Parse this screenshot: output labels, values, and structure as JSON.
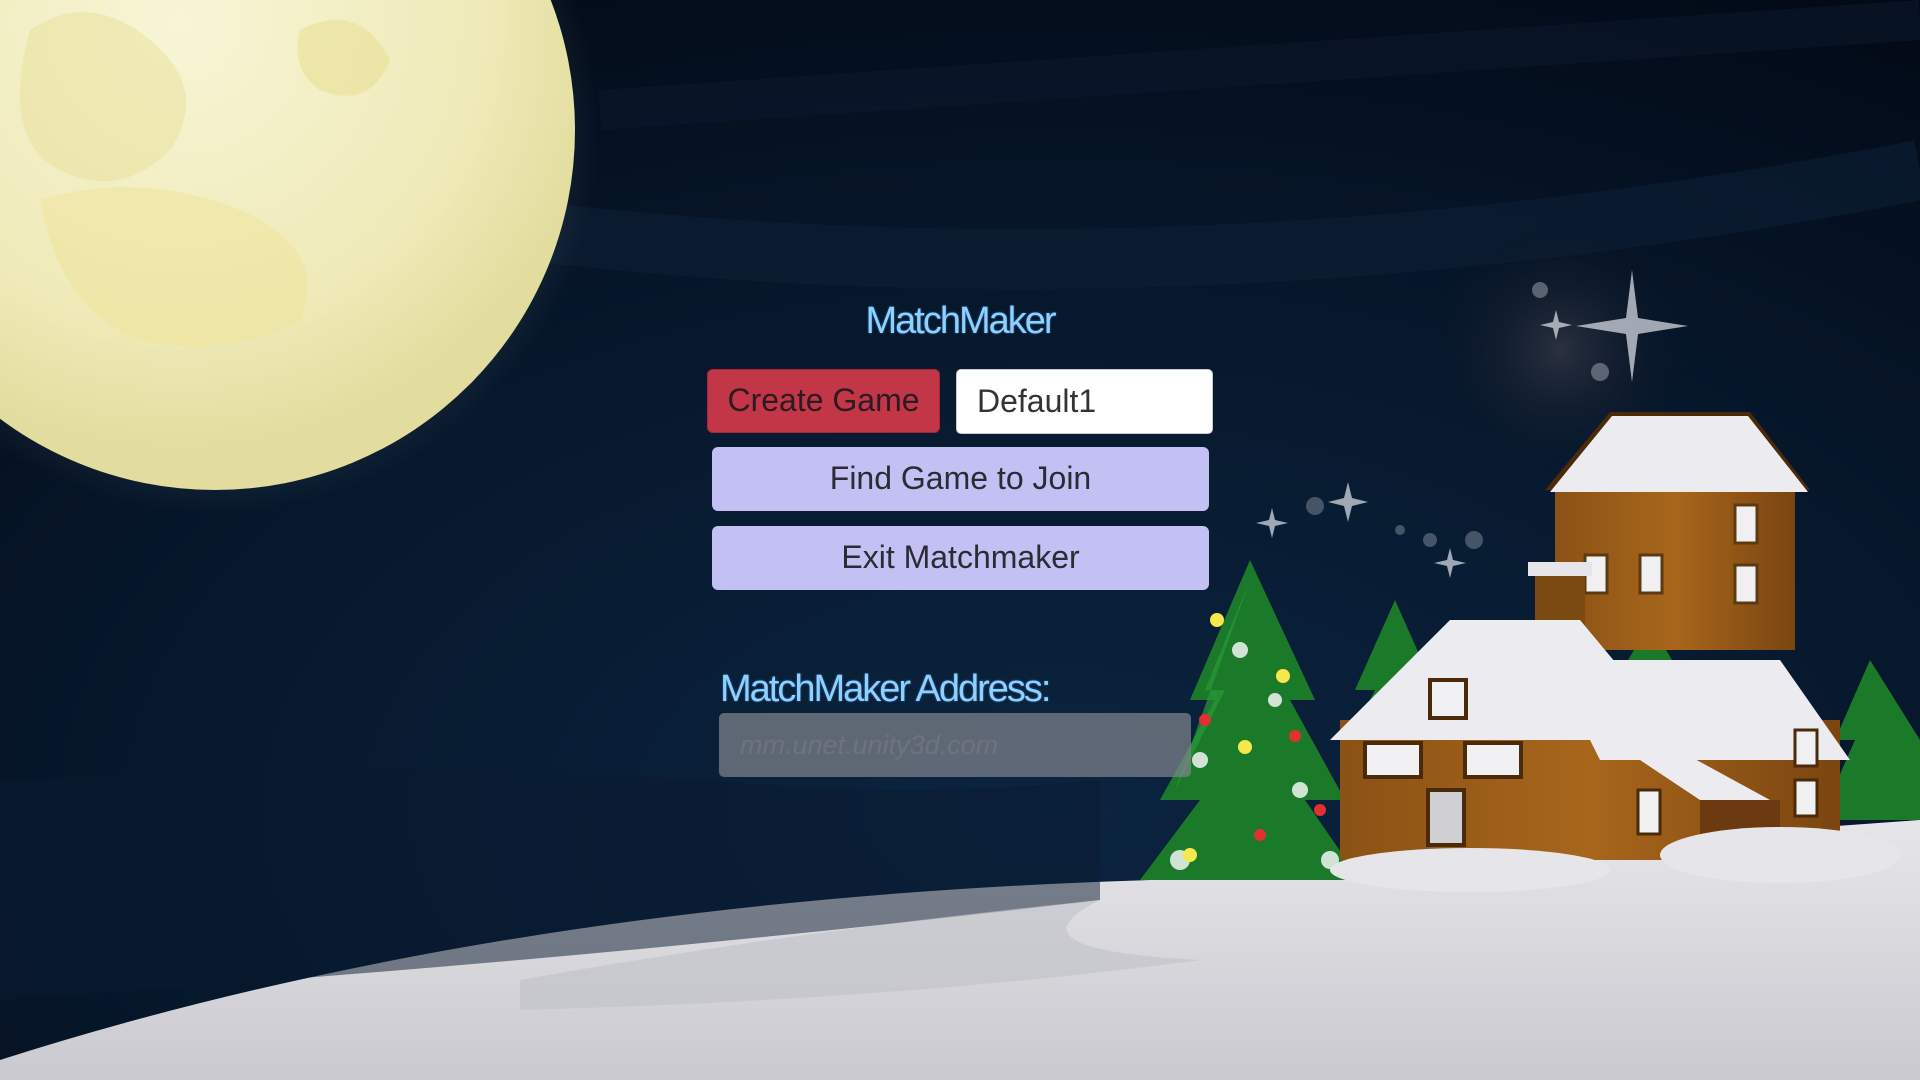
{
  "scene": {
    "background": "night-christmas-village",
    "sky_color": "#04101f",
    "moon_color": "#f4f1c2",
    "snow_color": "#d9d9de"
  },
  "menu": {
    "title": "MatchMaker",
    "create_label": "Create Game",
    "create_color": "#c33648",
    "room_name_value": "Default1",
    "find_label": "Find Game to Join",
    "exit_label": "Exit Matchmaker",
    "button_color": "#c3c0f3"
  },
  "address": {
    "label": "MatchMaker Address:",
    "placeholder": "mm.unet.unity3d.com"
  }
}
